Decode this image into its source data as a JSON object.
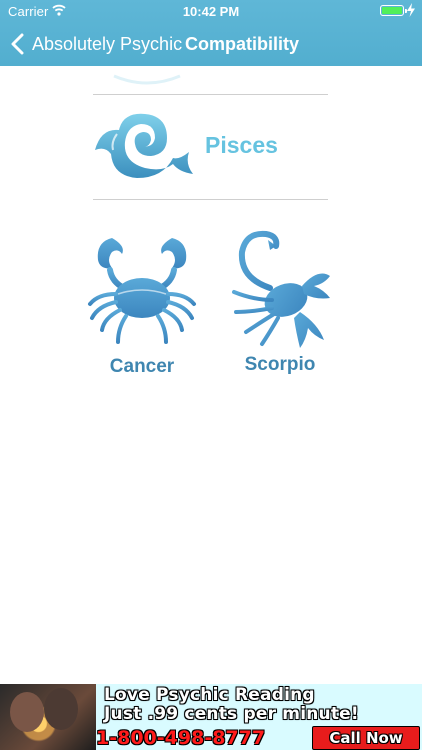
{
  "status_bar": {
    "carrier": "Carrier",
    "time": "10:42 PM",
    "battery_level": 1.0
  },
  "nav": {
    "back_label": "Absolutely Psychic",
    "title": "Compatibility"
  },
  "signs": {
    "pisces": "Pisces",
    "cancer": "Cancer",
    "scorpio": "Scorpio"
  },
  "ad": {
    "line1": "Love Psychic Reading",
    "line2": "Just .99 cents per minute!",
    "phone": "1-800-498-8777",
    "cta": "Call Now"
  },
  "colors": {
    "accent": "#52aecf",
    "sign_light": "#66c3e0",
    "sign_dark": "#3f86b0"
  },
  "icons": [
    "wifi-icon",
    "battery-icon",
    "charging-bolt-icon",
    "back-chevron-icon",
    "pisces-icon",
    "cancer-icon",
    "scorpio-icon"
  ]
}
